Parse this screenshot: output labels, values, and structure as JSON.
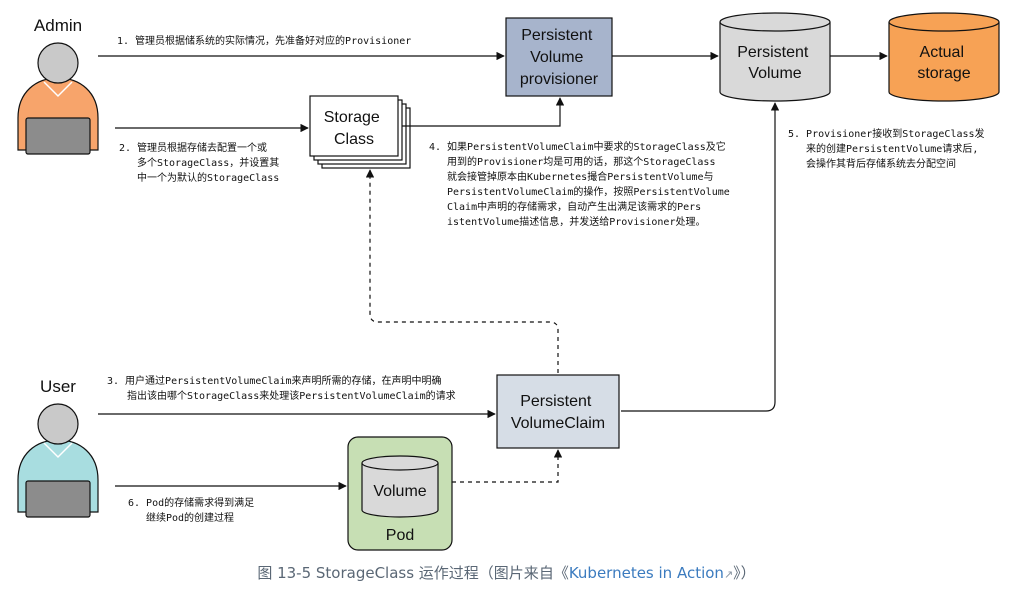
{
  "actors": {
    "admin": "Admin",
    "user": "User"
  },
  "boxes": {
    "pv_provisioner": [
      "Persistent",
      "Volume",
      "provisioner"
    ],
    "persistent_volume": [
      "Persistent",
      "Volume"
    ],
    "actual_storage": [
      "Actual",
      "storage"
    ],
    "storage_class": [
      "Storage",
      "Class"
    ],
    "pvc": [
      "Persistent",
      "VolumeClaim"
    ],
    "volume": "Volume",
    "pod": "Pod"
  },
  "notes": {
    "step1": [
      "1. 管理员根据储系统的实际情况，先准备好对应的Provisioner"
    ],
    "step2": [
      "2. 管理员根据存储去配置一个或",
      "多个StorageClass，并设置其",
      "中一个为默认的StorageClass"
    ],
    "step3": [
      "3. 用户通过PersistentVolumeClaim来声明所需的存储，在声明中明确",
      "指出该由哪个StorageClass来处理该PersistentVolumeClaim的请求"
    ],
    "step4": [
      "4. 如果PersistentVolumeClaim中要求的StorageClass及它",
      "用到的Provisioner均是可用的话，那这个StorageClass",
      "就会接管掉原本由Kubernetes撮合PersistentVolume与",
      "PersistentVolumeClaim的操作，按照PersistentVolume",
      "Claim中声明的存储需求，自动产生出满足该需求的Pers",
      "istentVolume描述信息，并发送给Provisioner处理。"
    ],
    "step5": [
      "5. Provisioner接收到StorageClass发",
      "来的创建PersistentVolume请求后,",
      "会操作其背后存储系统去分配空间"
    ],
    "step6": [
      "6. Pod的存储需求得到满足",
      "继续Pod的创建过程"
    ]
  },
  "colors": {
    "admin_body": "#f7a46b",
    "user_body": "#a8dde0",
    "person_head": "#c9c9c9",
    "laptop": "#8c8c8c",
    "provisioner_fill": "#a7b4cc",
    "volume_fill": "#d9d9d9",
    "actual_fill": "#f7a255",
    "pod_fill": "#c7dfb4",
    "pvc_fill": "#d6dde6"
  },
  "caption": {
    "prefix": "图 13-5 StorageClass 运作过程（图片来自《",
    "link": "Kubernetes in Action",
    "ext_icon": "external-link-icon",
    "suffix": "》）"
  }
}
